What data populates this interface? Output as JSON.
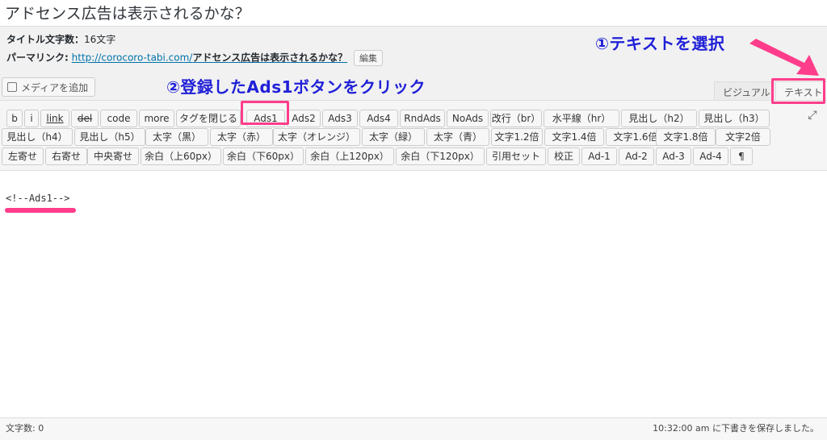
{
  "post": {
    "title": "アドセンス広告は表示されるかな？",
    "char_count_label": "タイトル文字数",
    "char_count_value": "16文字",
    "permalink_label": "パーマリンク:",
    "permalink_base": "http://corocoro-tabi.com/",
    "permalink_slug": "アドセンス広告は表示されるかな？",
    "edit_label": "編集"
  },
  "media": {
    "add_label": "メディアを追加"
  },
  "editor_tabs": {
    "visual": "ビジュアル",
    "text": "テキスト"
  },
  "quicktags": [
    "b",
    "i",
    "link",
    "del",
    "code",
    "more",
    "タグを閉じる",
    "Ads1",
    "Ads2",
    "Ads3",
    "Ads4",
    "RndAds",
    "NoAds",
    "改行（br）",
    "水平線（hr）",
    "見出し（h2）",
    "見出し（h3）",
    "見出し（h4）",
    "見出し（h5）",
    "太字（黒）",
    "太字（赤）",
    "太字（オレンジ）",
    "太字（緑）",
    "太字（青）",
    "文字1.2倍",
    "文字1.4倍",
    "文字1.6倍",
    "文字1.8倍",
    "文字2倍",
    "左寄せ",
    "右寄せ",
    "中央寄せ",
    "余白（上60px）",
    "余白（下60px）",
    "余白（上120px）",
    "余白（下120px）",
    "引用セット",
    "校正",
    "Ad-1",
    "Ad-2",
    "Ad-3",
    "Ad-4",
    "¶"
  ],
  "editor": {
    "content": "<!--Ads1-->"
  },
  "status": {
    "word_count": "文字数: 0",
    "draft_saved": "10:32:00 am に下書きを保存しました。"
  },
  "annotations": {
    "step1": "①テキストを選択",
    "step2": "②登録したAds1ボタンをクリック",
    "highlight_color": "#ff3d8b",
    "text_color": "#2020d8"
  }
}
